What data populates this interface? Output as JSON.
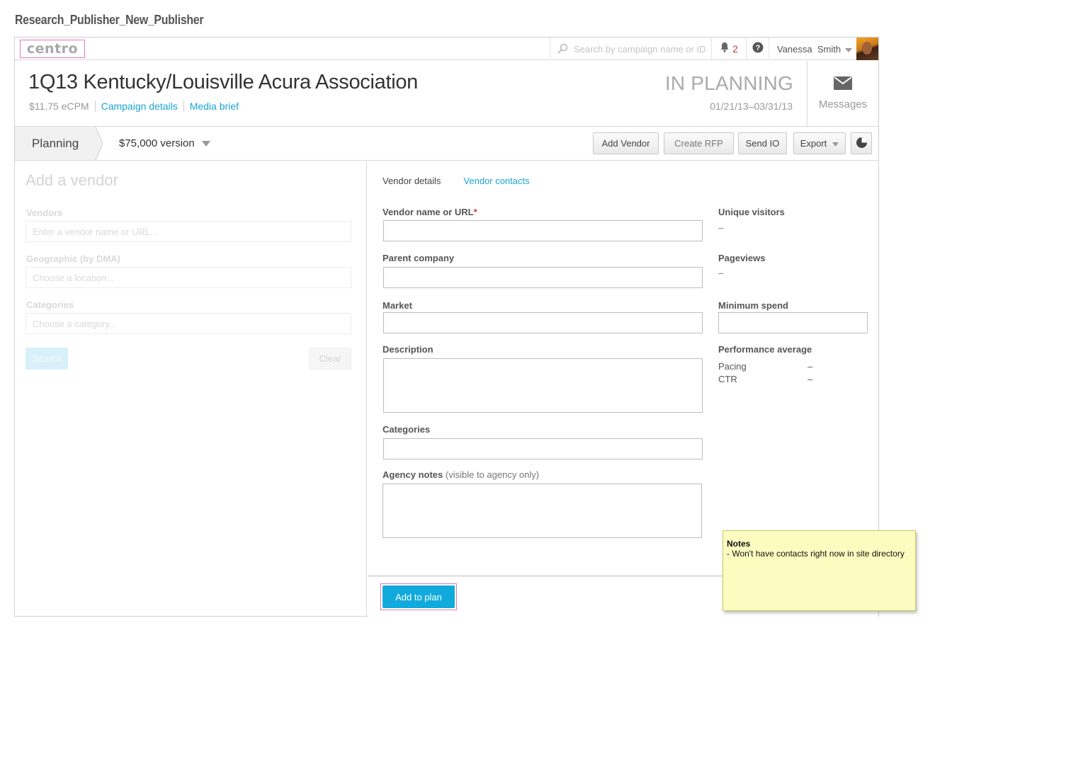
{
  "page": {
    "heading": "Research_Publisher_New_Publisher"
  },
  "topbar": {
    "logo_text": "centro",
    "search_placeholder": "Search by campaign name or ID",
    "notification_count": "2",
    "user_name": "Vanessa  Smith"
  },
  "header": {
    "campaign_title": "1Q13 Kentucky/Louisville Acura Association",
    "ecpm": "$11.75 eCPM",
    "campaign_details_link": "Campaign details",
    "media_brief_link": "Media brief",
    "status": "IN PLANNING",
    "dates": "01/21/13–03/31/13",
    "messages_label": "Messages"
  },
  "toolbar": {
    "crumb": "Planning",
    "version": "$75,000 version",
    "add_vendor": "Add Vendor",
    "create_rfp": "Create RFP",
    "send_io": "Send IO",
    "export": "Export"
  },
  "left_panel": {
    "title": "Add a vendor",
    "vendors_label": "Vendors",
    "vendors_placeholder": "Enter a vendor name or URL...",
    "geo_label": "Geographic (by DMA)",
    "geo_placeholder": "Choose a location...",
    "categories_label": "Categories",
    "categories_placeholder": "Choose a category...",
    "search_button": "Search",
    "clear_button": "Clear"
  },
  "right_panel": {
    "tab_details": "Vendor details",
    "tab_contacts": "Vendor contacts",
    "vendor_name_label": "Vendor name or URL",
    "required_mark": "*",
    "parent_company_label": "Parent company",
    "market_label": "Market",
    "description_label": "Description",
    "categories_label": "Categories",
    "agency_notes_label": "Agency notes",
    "agency_notes_sub": "(visible to agency only)",
    "unique_visitors_label": "Unique visitors",
    "unique_visitors_value": "–",
    "pageviews_label": "Pageviews",
    "pageviews_value": "–",
    "minimum_spend_label": "Minimum spend",
    "performance_label": "Performance average",
    "pacing_label": "Pacing",
    "pacing_value": "–",
    "ctr_label": "CTR",
    "ctr_value": "–",
    "add_to_plan": "Add to plan"
  },
  "note": {
    "title": "Notes",
    "body": "- Won't have contacts right now in site directory"
  },
  "colors": {
    "accent": "#1aa4d6",
    "primary_button": "#11aadd",
    "alert": "#d2373b",
    "highlight_border": "#e07bb0",
    "note_bg": "#fcfcc0"
  }
}
